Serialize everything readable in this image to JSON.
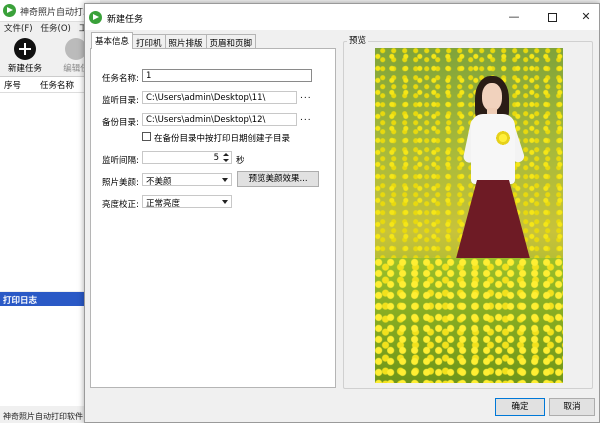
{
  "background_app": {
    "title": "神奇照片自动打印软",
    "menu": [
      "文件(F)",
      "任务(O)",
      "工"
    ],
    "toolbar": {
      "new_task": "新建任务",
      "edit_task": "编辑任"
    },
    "table_headers": [
      "序号",
      "任务名称"
    ],
    "log_title": "打印日志",
    "status": "神奇照片自动打印软件"
  },
  "dialog": {
    "title": "新建任务",
    "window_buttons": {
      "minimize": "—",
      "close": "✕"
    },
    "tabs": [
      "基本信息",
      "打印机",
      "照片排版",
      "页眉和页脚"
    ],
    "active_tab": "基本信息",
    "form": {
      "task_name_label": "任务名称:",
      "task_name_value": "1",
      "watch_dir_label": "监听目录:",
      "watch_dir_value": "C:\\Users\\admin\\Desktop\\11\\",
      "backup_dir_label": "备份目录:",
      "backup_dir_value": "C:\\Users\\admin\\Desktop\\12\\",
      "browse_label": "...",
      "subdir_checkbox_label": "在备份目录中按打印日期创建子目录",
      "subdir_checked": false,
      "interval_label": "监听间隔:",
      "interval_value": "5",
      "interval_unit": "秒",
      "beauty_label": "照片美颜:",
      "beauty_value": "不美颜",
      "preview_beauty_button": "预览美颜效果...",
      "brightness_label": "亮度校正:",
      "brightness_value": "正常亮度"
    },
    "preview_label": "预览",
    "ok_button": "确定",
    "cancel_button": "取消"
  }
}
